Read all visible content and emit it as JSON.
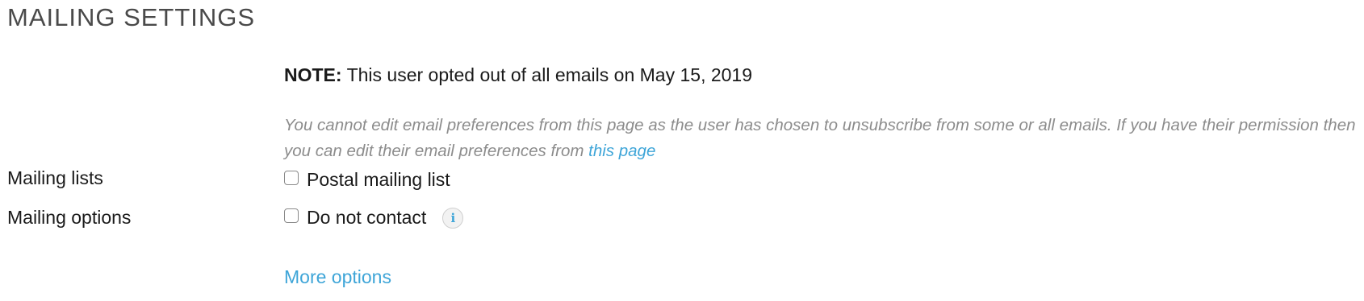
{
  "section": {
    "title": "MAILING SETTINGS"
  },
  "note": {
    "label": "NOTE:",
    "text": "This user opted out of all emails on May 15, 2019"
  },
  "help": {
    "text_before_link": "You cannot edit email preferences from this page as the user has chosen to unsubscribe from some or all emails. If you have their permission then you can edit their email preferences from ",
    "link_label": "this page"
  },
  "mailing_lists": {
    "label": "Mailing lists",
    "options": [
      {
        "label": "Postal mailing list",
        "checked": false
      }
    ]
  },
  "mailing_options": {
    "label": "Mailing options",
    "options": [
      {
        "label": "Do not contact",
        "checked": false,
        "icon": "info-icon"
      }
    ]
  },
  "more_options_label": "More options",
  "colors": {
    "link": "#3ea5d8",
    "help_text": "#8c8c8c",
    "heading": "#4a4a4a"
  }
}
